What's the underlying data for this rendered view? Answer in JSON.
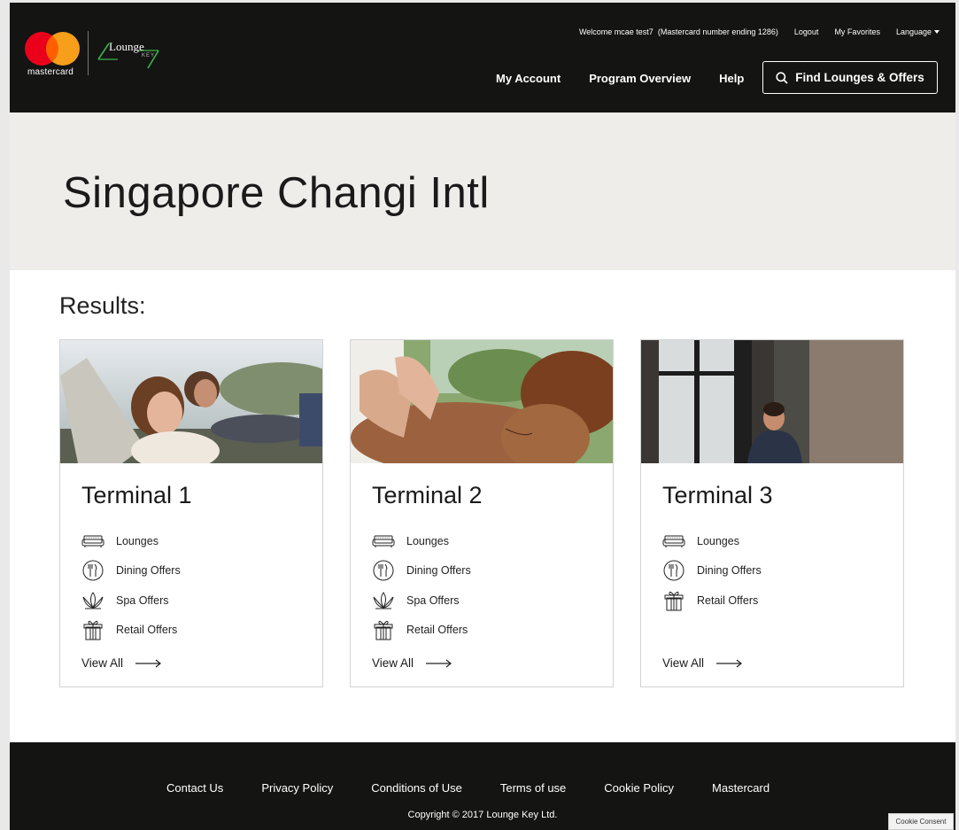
{
  "brand": {
    "mastercard_label": "mastercard",
    "lounge_label": "Lounge",
    "key_label": "KEY",
    "colors": {
      "red": "#eb001b",
      "yellow": "#f79e1b",
      "overlap": "#ff5f00",
      "green": "#3bb54a"
    }
  },
  "header": {
    "welcome": "Welcome mcae test7",
    "card_info": "(Mastercard number ending 1286)",
    "logout": "Logout",
    "favorites": "My Favorites",
    "language": "Language",
    "nav": {
      "my_account": "My Account",
      "program_overview": "Program Overview",
      "help": "Help"
    },
    "find_button": "Find Lounges & Offers"
  },
  "hero": {
    "title": "Singapore Changi Intl"
  },
  "results_label": "Results:",
  "cards": [
    {
      "title": "Terminal 1",
      "offers": [
        "Lounges",
        "Dining Offers",
        "Spa Offers",
        "Retail Offers"
      ],
      "view_all": "View All"
    },
    {
      "title": "Terminal 2",
      "offers": [
        "Lounges",
        "Dining Offers",
        "Spa Offers",
        "Retail Offers"
      ],
      "view_all": "View All"
    },
    {
      "title": "Terminal 3",
      "offers": [
        "Lounges",
        "Dining Offers",
        "Retail Offers"
      ],
      "view_all": "View All"
    }
  ],
  "footer": {
    "links": [
      "Contact Us",
      "Privacy Policy",
      "Conditions of Use",
      "Terms of use",
      "Cookie Policy",
      "Mastercard"
    ],
    "copyright": "Copyright © 2017 Lounge Key Ltd."
  },
  "cookie_button": "Cookie Consent",
  "icons": {
    "lounges": "sofa-icon",
    "dining": "fork-knife-icon",
    "spa": "lotus-icon",
    "retail": "gift-icon",
    "search": "search-icon",
    "arrow": "arrow-right-icon"
  }
}
